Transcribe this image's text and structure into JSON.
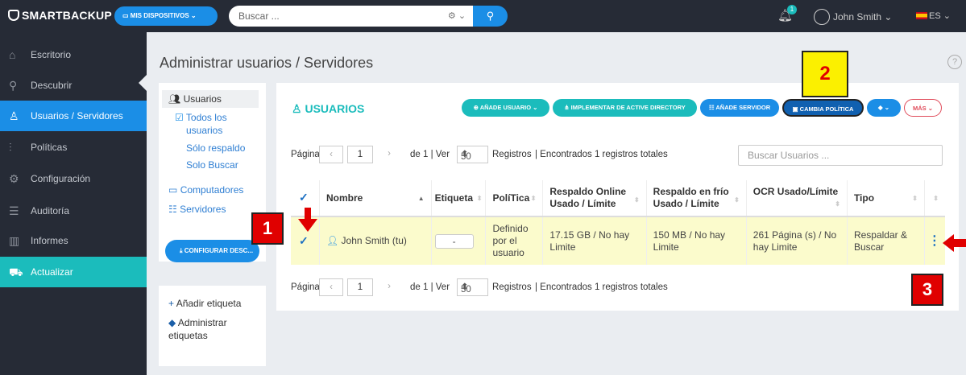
{
  "topbar": {
    "logo": "SMARTBACKUP",
    "devices_label": "MIS DISPOSITIVOS",
    "search_placeholder": "Buscar ...",
    "search_icon": "search-icon",
    "notification_count": "1",
    "user_name": "John Smith",
    "language": "ES"
  },
  "sidebar": {
    "items": [
      {
        "label": "Escritorio",
        "icon": "home-icon"
      },
      {
        "label": "Descubrir",
        "icon": "search-icon"
      },
      {
        "label": "Usuarios / Servidores",
        "icon": "users-icon"
      },
      {
        "label": "Políticas",
        "icon": "sliders-icon"
      },
      {
        "label": "Configuración",
        "icon": "gear-icon"
      },
      {
        "label": "Auditoría",
        "icon": "list-icon"
      },
      {
        "label": "Informes",
        "icon": "bar-chart-icon"
      },
      {
        "label": "Actualizar",
        "icon": "cart-icon"
      }
    ]
  },
  "page": {
    "title": "Administrar usuarios / Servidores",
    "help": "?"
  },
  "left_panel": {
    "users_heading": "Usuarios",
    "all_users": "Todos los usuarios",
    "all_users_line1": "Todos los",
    "all_users_line2": "usuarios",
    "backup_only": "Sólo respaldo",
    "search_only": "Solo Buscar",
    "computers": "Computadores",
    "servers": "Servidores",
    "configure_button": "CONFIGURAR DESC...",
    "add_tag": "Añadir etiqueta",
    "manage_tags_line1": "Administrar",
    "manage_tags_line2": "etiquetas"
  },
  "main": {
    "section_title": "USUARIOS",
    "buttons": {
      "add_user": "AÑADE USUARIO",
      "active_directory": "IMPLEMENTAR DE ACTIVE DIRECTORY",
      "add_server": "AÑADE SERVIDOR",
      "change_policy": "CAMBIA POLÍTICA",
      "more": "MÁS"
    },
    "pager": {
      "page_label": "Página",
      "prev": "‹",
      "page_value": "1",
      "next": "›",
      "of_label": "de 1 | Ver",
      "per_page": "50",
      "records_label": "Registros",
      "found": "| Encontrados 1 registros totales"
    },
    "search_placeholder": "Buscar Usuarios ...",
    "table": {
      "headers": [
        "Nombre",
        "Etiqueta",
        "PolíTica",
        "Respaldo Online Usado / Límite",
        "Respaldo en frío Usado / Límite",
        "OCR Usado/Límite",
        "Tipo"
      ],
      "rows": [
        {
          "name": "John Smith (tu)",
          "tag": "-",
          "policy": "Definido por el usuario",
          "online": "17.15 GB / No hay Limite",
          "cold": "150 MB / No hay Limite",
          "ocr": "261 Página (s) / No hay Limite",
          "type": "Respaldar & Buscar"
        }
      ]
    }
  },
  "annotations": {
    "marker_1": "1",
    "marker_2": "2",
    "marker_3": "3"
  }
}
